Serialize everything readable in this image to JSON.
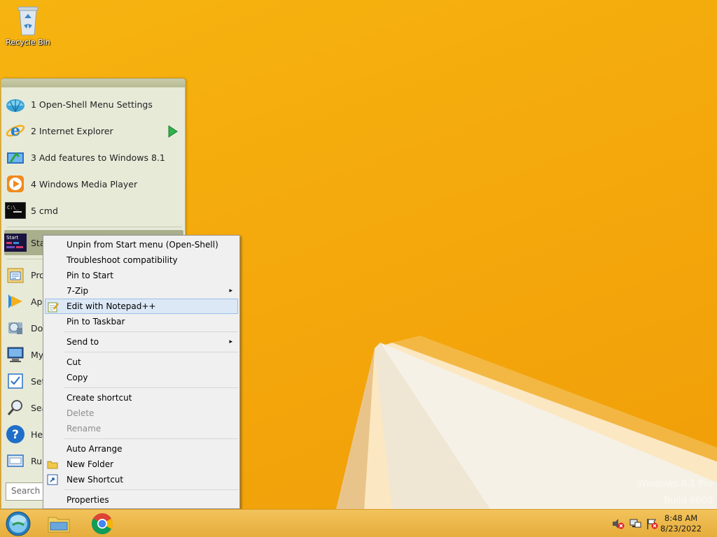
{
  "desktop": {
    "recycle_bin_label": "Recycle Bin",
    "watermark_line1": "Windows 8.1 Pro",
    "watermark_line2": "Build 9600"
  },
  "start_menu": {
    "pinned": [
      {
        "label": "1 Open-Shell Menu Settings",
        "icon": "open-shell-icon"
      },
      {
        "label": "2 Internet Explorer",
        "icon": "internet-explorer-icon",
        "has_submenu": true
      },
      {
        "label": "3 Add features to Windows 8.1",
        "icon": "add-features-icon"
      },
      {
        "label": "4 Windows Media Player",
        "icon": "media-player-icon"
      },
      {
        "label": "5 cmd",
        "icon": "cmd-icon"
      }
    ],
    "start_item_icon_text": "Start",
    "selected_item_label": "Sta",
    "lower_items": [
      {
        "label": "Pro",
        "icon": "programs-icon"
      },
      {
        "label": "Ap",
        "icon": "apps-icon"
      },
      {
        "label": "Do",
        "icon": "documents-icon"
      },
      {
        "label": "My",
        "icon": "computer-icon"
      },
      {
        "label": "Set",
        "icon": "settings-icon"
      },
      {
        "label": "Sea",
        "icon": "search-icon"
      },
      {
        "label": "He",
        "icon": "help-icon"
      },
      {
        "label": "Ru",
        "icon": "run-icon"
      }
    ],
    "search_placeholder": "Search"
  },
  "context_menu": {
    "items": [
      {
        "label": "Unpin from Start menu (Open-Shell)"
      },
      {
        "label": "Troubleshoot compatibility"
      },
      {
        "label": "Pin to Start"
      },
      {
        "label": "7-Zip",
        "submenu": true
      },
      {
        "label": "Edit with Notepad++",
        "icon": "notepad-plus-plus-icon",
        "highlighted": true
      },
      {
        "label": "Pin to Taskbar"
      },
      {
        "label": "Send to",
        "submenu": true
      },
      {
        "label": "Cut"
      },
      {
        "label": "Copy"
      },
      {
        "label": "Create shortcut"
      },
      {
        "label": "Delete",
        "disabled": true
      },
      {
        "label": "Rename",
        "disabled": true
      },
      {
        "label": "Auto Arrange"
      },
      {
        "label": "New Folder",
        "icon": "folder-icon"
      },
      {
        "label": "New Shortcut",
        "icon": "shortcut-icon"
      },
      {
        "label": "Properties"
      }
    ],
    "submenu_arrow": "▸"
  },
  "taskbar": {
    "buttons": [
      {
        "name": "start-orb",
        "icon": "start-orb-icon"
      },
      {
        "name": "file-explorer",
        "icon": "folder-icon"
      },
      {
        "name": "chrome",
        "icon": "chrome-icon"
      }
    ],
    "tray_icons": [
      "volume-muted-icon",
      "network-icon",
      "action-center-flag-icon"
    ],
    "clock_time": "8:48 AM",
    "clock_date": "8/23/2022"
  },
  "colors": {
    "wallpaper": "#f4a90c",
    "menu_bg": "#e8ead8",
    "context_highlight": "#dce8f6"
  }
}
